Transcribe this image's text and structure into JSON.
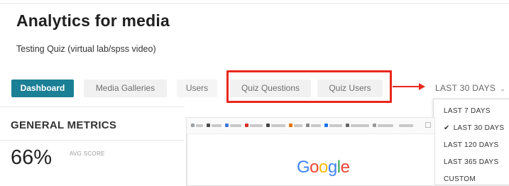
{
  "page": {
    "title": "Analytics for media",
    "subtitle": "Testing Quiz (virtual lab/spss video)"
  },
  "tabs": [
    {
      "label": "Dashboard",
      "active": true
    },
    {
      "label": "Media Galleries",
      "active": false
    },
    {
      "label": "Users",
      "active": false
    },
    {
      "label": "Quiz Questions",
      "active": false
    },
    {
      "label": "Quiz Users",
      "active": false
    }
  ],
  "date_range": {
    "selected": "LAST 30 DAYS",
    "options": [
      {
        "label": "LAST 7 DAYS",
        "checked": false
      },
      {
        "label": "LAST 30 DAYS",
        "checked": true
      },
      {
        "label": "LAST 120 DAYS",
        "checked": false
      },
      {
        "label": "LAST 365 DAYS",
        "checked": false
      },
      {
        "label": "CUSTOM",
        "checked": false
      }
    ]
  },
  "metrics": {
    "title": "GENERAL METRICS",
    "avg_score_value": "66%",
    "avg_score_label": "AVG SCORE"
  },
  "preview": {
    "logo_text": "Google"
  },
  "colors": {
    "accent": "#1b7f95",
    "annotation_red": "#e8281d"
  }
}
